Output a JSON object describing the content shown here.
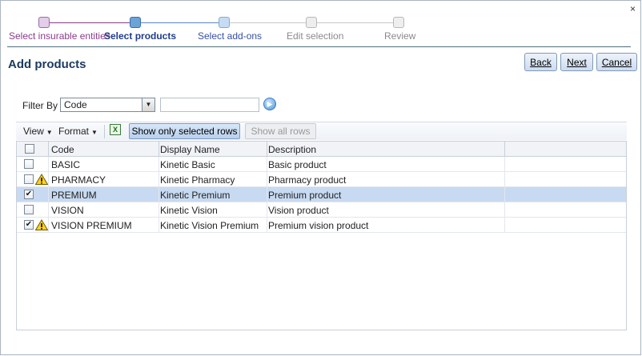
{
  "window": {
    "close_label": "×"
  },
  "wizard": {
    "steps": [
      {
        "label": "Select insurable entities",
        "state": "done"
      },
      {
        "label": "Select products",
        "state": "current"
      },
      {
        "label": "Select add-ons",
        "state": "next"
      },
      {
        "label": "Edit selection",
        "state": "future"
      },
      {
        "label": "Review",
        "state": "future"
      }
    ]
  },
  "page": {
    "title": "Add products"
  },
  "nav_buttons": {
    "back": "Back",
    "next": "Next",
    "cancel": "Cancel"
  },
  "filter": {
    "label": "Filter By",
    "field_value": "Code",
    "search_value": ""
  },
  "toolbar": {
    "view_label": "View",
    "format_label": "Format",
    "show_selected_label": "Show only selected rows",
    "show_all_label": "Show all rows"
  },
  "table": {
    "columns": [
      "Code",
      "Display Name",
      "Description"
    ],
    "rows": [
      {
        "checked": false,
        "warning": false,
        "selected": false,
        "code": "BASIC",
        "display_name": "Kinetic Basic",
        "description": "Basic product"
      },
      {
        "checked": false,
        "warning": true,
        "selected": false,
        "code": "PHARMACY",
        "display_name": "Kinetic Pharmacy",
        "description": "Pharmacy product"
      },
      {
        "checked": true,
        "warning": false,
        "selected": true,
        "code": "PREMIUM",
        "display_name": "Kinetic Premium",
        "description": "Premium product"
      },
      {
        "checked": false,
        "warning": false,
        "selected": false,
        "code": "VISION",
        "display_name": "Kinetic Vision",
        "description": "Vision product"
      },
      {
        "checked": true,
        "warning": true,
        "selected": false,
        "code": "VISION PREMIUM",
        "display_name": "Kinetic Vision Premium",
        "description": "Premium vision product"
      }
    ]
  },
  "colors": {
    "done": "#8b3c8c",
    "current": "#1f3d8a",
    "next": "#3650a0",
    "future": "#8a8a8a",
    "row_selected": "#c7daf1"
  }
}
